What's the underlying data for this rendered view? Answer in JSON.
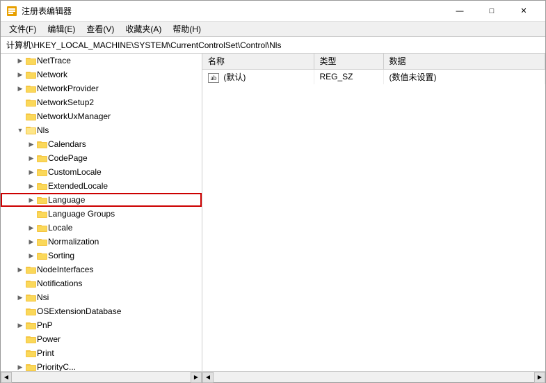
{
  "window": {
    "title": "注册表编辑器",
    "controls": {
      "minimize": "—",
      "maximize": "□",
      "close": "✕"
    }
  },
  "menu": {
    "items": [
      "文件(F)",
      "编辑(E)",
      "查看(V)",
      "收藏夹(A)",
      "帮助(H)"
    ]
  },
  "address": {
    "label": "计算机\\HKEY_LOCAL_MACHINE\\SYSTEM\\CurrentControlSet\\Control\\Nls"
  },
  "tree": {
    "items": [
      {
        "id": "nettrace",
        "label": "NetTrace",
        "indent": 1,
        "expand": "▶",
        "hasChildren": true
      },
      {
        "id": "network",
        "label": "Network",
        "indent": 1,
        "expand": "▶",
        "hasChildren": true
      },
      {
        "id": "networkprovider",
        "label": "NetworkProvider",
        "indent": 1,
        "expand": "▶",
        "hasChildren": true
      },
      {
        "id": "networksetup2",
        "label": "NetworkSetup2",
        "indent": 1,
        "expand": "",
        "hasChildren": false
      },
      {
        "id": "networkuxmanager",
        "label": "NetworkUxManager",
        "indent": 1,
        "expand": "",
        "hasChildren": false
      },
      {
        "id": "nls",
        "label": "Nls",
        "indent": 1,
        "expand": "▼",
        "hasChildren": true,
        "expanded": true
      },
      {
        "id": "calendars",
        "label": "Calendars",
        "indent": 2,
        "expand": "▶",
        "hasChildren": true
      },
      {
        "id": "codepage",
        "label": "CodePage",
        "indent": 2,
        "expand": "▶",
        "hasChildren": true
      },
      {
        "id": "customlocale",
        "label": "CustomLocale",
        "indent": 2,
        "expand": "▶",
        "hasChildren": true
      },
      {
        "id": "extendedlocale",
        "label": "ExtendedLocale",
        "indent": 2,
        "expand": "▶",
        "hasChildren": true
      },
      {
        "id": "language",
        "label": "Language",
        "indent": 2,
        "expand": "▶",
        "hasChildren": true,
        "highlighted": true
      },
      {
        "id": "languagegroups",
        "label": "Language Groups",
        "indent": 2,
        "expand": "▶",
        "hasChildren": true
      },
      {
        "id": "locale",
        "label": "Locale",
        "indent": 2,
        "expand": "▶",
        "hasChildren": true
      },
      {
        "id": "normalization",
        "label": "Normalization",
        "indent": 2,
        "expand": "▶",
        "hasChildren": true
      },
      {
        "id": "sorting",
        "label": "Sorting",
        "indent": 2,
        "expand": "▶",
        "hasChildren": true
      },
      {
        "id": "nodeinterfaces",
        "label": "NodeInterfaces",
        "indent": 1,
        "expand": "▶",
        "hasChildren": true
      },
      {
        "id": "notifications",
        "label": "Notifications",
        "indent": 1,
        "expand": "",
        "hasChildren": false
      },
      {
        "id": "nsi",
        "label": "Nsi",
        "indent": 1,
        "expand": "▶",
        "hasChildren": true
      },
      {
        "id": "osextensiondatabase",
        "label": "OSExtensionDatabase",
        "indent": 1,
        "expand": "",
        "hasChildren": false
      },
      {
        "id": "pnp",
        "label": "PnP",
        "indent": 1,
        "expand": "▶",
        "hasChildren": true
      },
      {
        "id": "power",
        "label": "Power",
        "indent": 1,
        "expand": "",
        "hasChildren": false
      },
      {
        "id": "print",
        "label": "Print",
        "indent": 1,
        "expand": "",
        "hasChildren": false
      },
      {
        "id": "prioritycontrol",
        "label": "PriorityC...",
        "indent": 1,
        "expand": "▶",
        "hasChildren": true
      }
    ]
  },
  "table": {
    "columns": [
      "名称",
      "类型",
      "数据"
    ],
    "rows": [
      {
        "name": "(默认)",
        "type": "REG_SZ",
        "data": "(数值未设置)",
        "isDefault": true
      }
    ]
  }
}
